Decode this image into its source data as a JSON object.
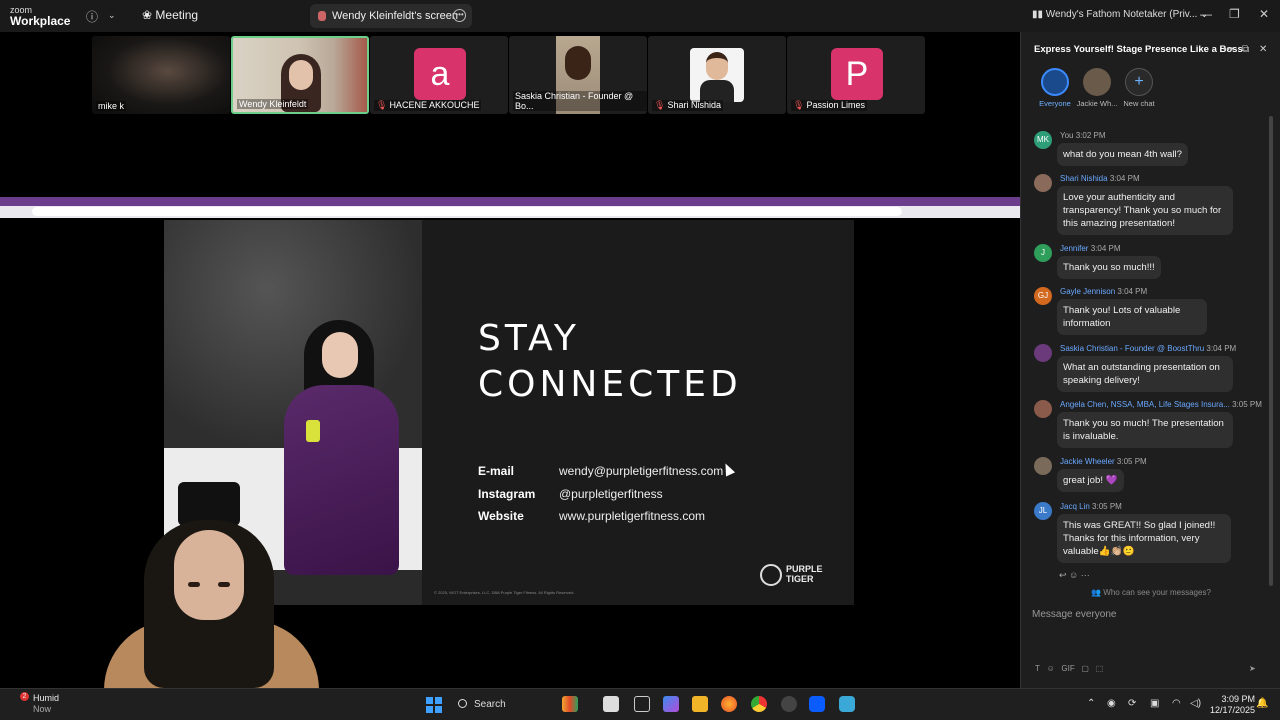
{
  "titlebar": {
    "logo_top": "zoom",
    "logo_bottom": "Workplace",
    "meeting_label": "Meeting",
    "share_label": "Wendy Kleinfeldt's screen",
    "notetaker_label": "Wendy's Fathom Notetaker (Priv..."
  },
  "participants": [
    {
      "name": "mike k",
      "type": "video",
      "muted": false
    },
    {
      "name": "Wendy Kleinfeldt",
      "type": "video",
      "muted": false,
      "active": true
    },
    {
      "name": "HACENE AKKOUCHE",
      "type": "avatar",
      "letter": "a",
      "color": "#d9336b",
      "muted": true
    },
    {
      "name": "Saskia Christian - Founder @ Bo...",
      "type": "video",
      "muted": false
    },
    {
      "name": "Shari Nishida",
      "type": "photo",
      "muted": true
    },
    {
      "name": "Passion Limes",
      "type": "avatar",
      "letter": "P",
      "color": "#d9336b",
      "muted": true
    }
  ],
  "slide": {
    "heading_line1": "STAY",
    "heading_line2": "CONNECTED",
    "contacts": [
      {
        "label": "E-mail",
        "value": "wendy@purpletigerfitness.com"
      },
      {
        "label": "Instagram",
        "value": "@purpletigerfitness"
      },
      {
        "label": "Website",
        "value": "www.purpletigerfitness.com"
      }
    ],
    "copyright": "© 2025, WOT Enterprises, LLC. DBA Purple Tiger Fitness. All Rights Reserved.",
    "brand_line1": "PURPLE",
    "brand_line2": "TIGER"
  },
  "chat": {
    "title": "Express Yourself! Stage Presence Like a Boss",
    "tabs": [
      {
        "label": "Everyone",
        "selected": true
      },
      {
        "label": "Jackie Wh...",
        "selected": false
      },
      {
        "label": "New chat",
        "selected": false
      }
    ],
    "messages": [
      {
        "sender": "You",
        "time": "3:02 PM",
        "avatar": "MK",
        "avatar_color": "#2e9e78",
        "text": "what do you mean 4th wall?"
      },
      {
        "sender": "Shari Nishida",
        "time": "3:04 PM",
        "avatar": "",
        "avatar_color": "#8a6a5a",
        "text": "Love your authenticity and transparency!  Thank you so much for this amazing presentation!"
      },
      {
        "sender": "Jennifer",
        "time": "3:04 PM",
        "avatar": "J",
        "avatar_color": "#2e9e5a",
        "text": "Thank you so much!!!"
      },
      {
        "sender": "Gayle Jennison",
        "time": "3:04 PM",
        "avatar": "GJ",
        "avatar_color": "#d2691e",
        "text": "Thank you! Lots of valuable information"
      },
      {
        "sender": "Saskia Christian - Founder @ BoostThru",
        "time": "3:04 PM",
        "avatar": "",
        "avatar_color": "#6a3a7a",
        "text": "What an outstanding presentation on speaking delivery!"
      },
      {
        "sender": "Angela Chen, NSSA, MBA, Life Stages Insura...",
        "time": "3:05 PM",
        "avatar": "",
        "avatar_color": "#8a5a4a",
        "text": "Thank you so much! The presentation is invaluable."
      },
      {
        "sender": "Jackie Wheeler",
        "time": "3:05 PM",
        "avatar": "",
        "avatar_color": "#7a6a5a",
        "text": "great job! 💜"
      },
      {
        "sender": "Jacq Lin",
        "time": "3:05 PM",
        "avatar": "JL",
        "avatar_color": "#3a7ac8",
        "text": "This was GREAT!! So glad I joined!! Thanks for this information, very valuable👍👏🏼🙂"
      }
    ],
    "who_can_see": "Who can see your messages?",
    "input_placeholder": "Message everyone"
  },
  "taskbar": {
    "weather_title": "Humid",
    "weather_sub": "Now",
    "weather_badge": "2",
    "search_label": "Search",
    "time": "3:09 PM",
    "date": "12/17/2025"
  }
}
